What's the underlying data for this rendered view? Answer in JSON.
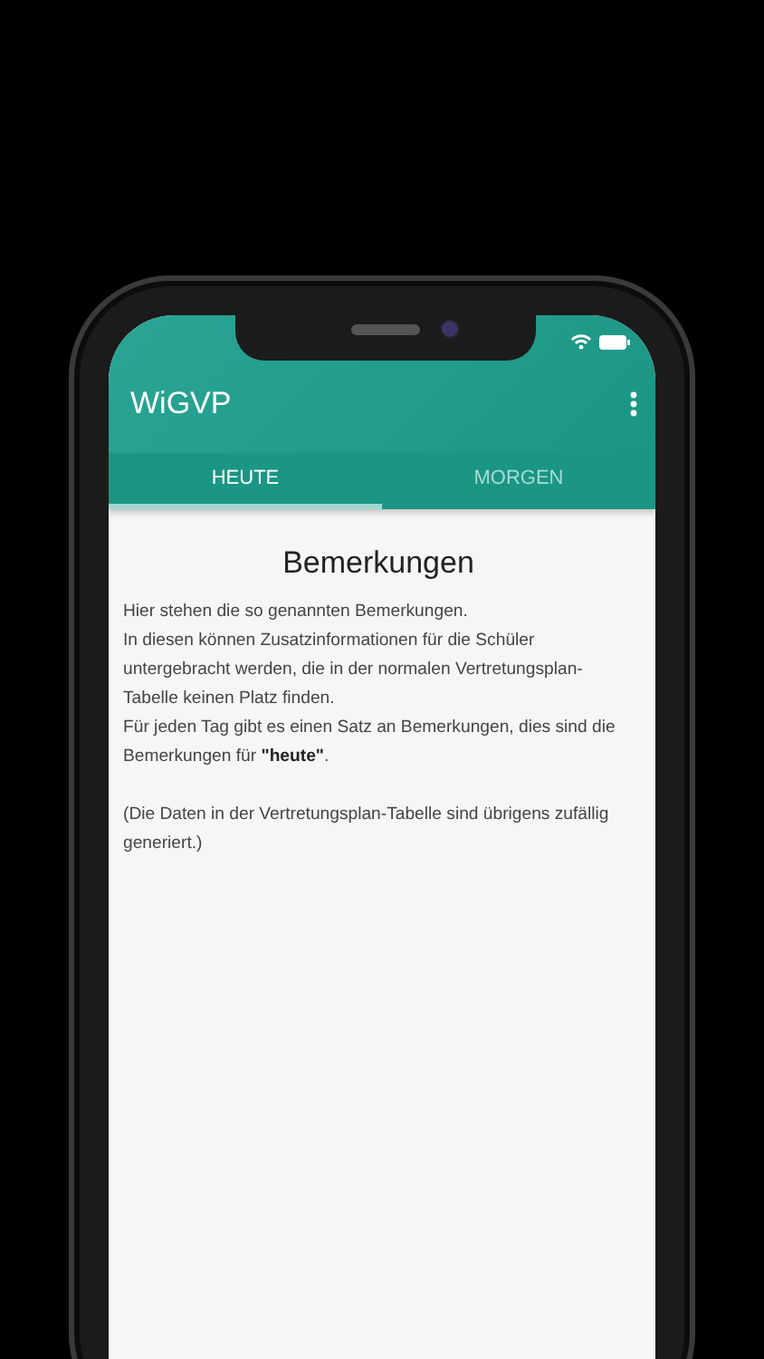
{
  "app_bar": {
    "title": "WiGVP"
  },
  "tabs": [
    {
      "label": "HEUTE",
      "selected": true
    },
    {
      "label": "MORGEN",
      "selected": false
    }
  ],
  "remarks": {
    "heading": "Bemerkungen",
    "blocks": [
      [
        "Hier stehen die so genannten Bemerkungen.",
        "In diesen können Zusatzinformationen für die Schüler untergebracht werden, die in der normalen Vertretungsplan-Tabelle keinen Platz finden.",
        "Für jeden Tag gibt es einen Satz an Bemerkungen, dies sind die Bemerkungen für **\"heute\"**."
      ],
      [
        "(Die Daten in der Vertretungsplan-Tabelle sind übrigens zufällig generiert.)"
      ]
    ]
  }
}
